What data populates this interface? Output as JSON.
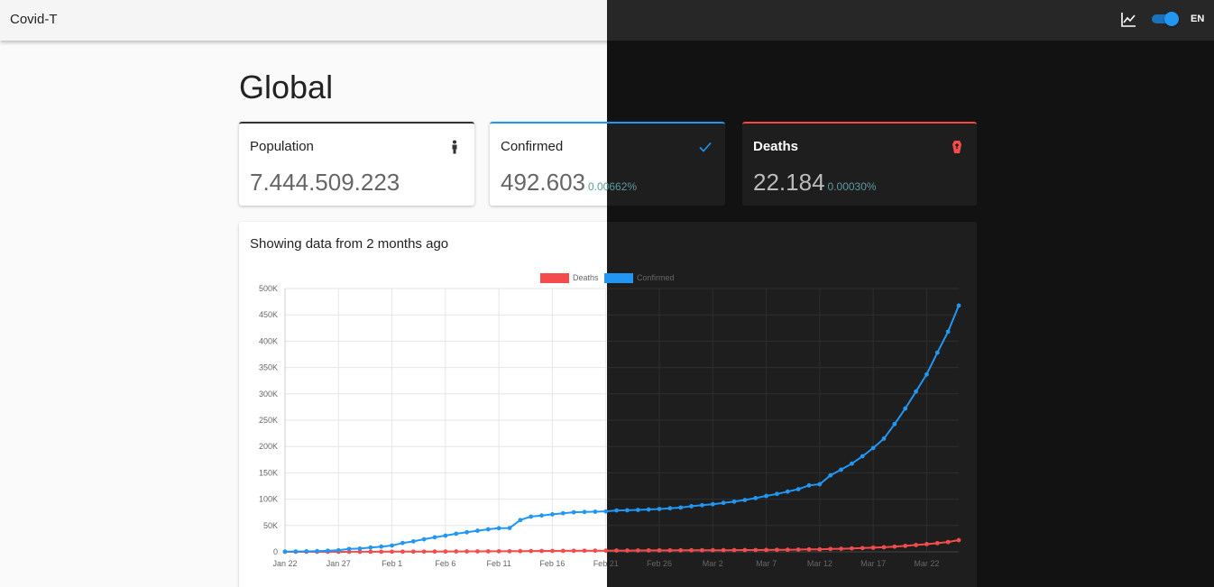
{
  "app": {
    "brand": "Covid-T",
    "language": "EN",
    "icons": {
      "chart": "chart-line-icon",
      "theme_toggle": "theme-toggle",
      "population": "person-icon",
      "confirmed": "check-icon",
      "deaths": "coffin-icon"
    },
    "theme": {
      "dark_mode": true,
      "accent": "#2196f3",
      "deaths_color": "#f44c4c"
    }
  },
  "page": {
    "title": "Global"
  },
  "cards": {
    "population": {
      "label": "Population",
      "value": "7.444.509.223"
    },
    "confirmed": {
      "label": "Confirmed",
      "value": "492.603",
      "percent": "0.00662%"
    },
    "deaths": {
      "label": "Deaths",
      "value": "22.184",
      "percent": "0.00030%"
    }
  },
  "chart_section": {
    "heading": "Showing data from 2 months ago"
  },
  "chart_data": {
    "type": "line",
    "title": "",
    "xlabel": "",
    "ylabel": "",
    "ylim": [
      0,
      500000
    ],
    "y_ticks": [
      "0",
      "50K",
      "100K",
      "150K",
      "200K",
      "250K",
      "300K",
      "350K",
      "400K",
      "450K",
      "500K"
    ],
    "x_tick_labels": [
      "Jan 22",
      "Jan 27",
      "Feb 1",
      "Feb 6",
      "Feb 11",
      "Feb 16",
      "Feb 21",
      "Feb 26",
      "Mar 2",
      "Mar 7",
      "Mar 12",
      "Mar 17",
      "Mar 22"
    ],
    "x_start": "Jan 22",
    "x_end": "Mar 25",
    "legend_position": "top",
    "grid": true,
    "series": [
      {
        "name": "Deaths",
        "color": "#f44c4c",
        "values": [
          17,
          18,
          26,
          42,
          56,
          82,
          131,
          133,
          171,
          213,
          259,
          362,
          426,
          492,
          564,
          634,
          719,
          806,
          906,
          1013,
          1113,
          1118,
          1371,
          1523,
          1666,
          1770,
          1868,
          2007,
          2122,
          2247,
          2251,
          2458,
          2469,
          2629,
          2708,
          2770,
          2814,
          2872,
          2941,
          2996,
          3085,
          3160,
          3254,
          3348,
          3460,
          3558,
          3802,
          3988,
          4262,
          4615,
          4720,
          5404,
          5819,
          6440,
          7126,
          7905,
          8733,
          9867,
          11299,
          12973,
          14623,
          16497,
          18615,
          22184
        ]
      },
      {
        "name": "Confirmed",
        "color": "#2196f3",
        "values": [
          555,
          654,
          941,
          1434,
          2118,
          2927,
          5578,
          6166,
          8234,
          9927,
          12038,
          16787,
          19881,
          23892,
          27635,
          30794,
          34391,
          37120,
          40150,
          42762,
          44802,
          45221,
          60368,
          66885,
          69030,
          71224,
          73258,
          75136,
          75639,
          76197,
          76819,
          78572,
          78958,
          79561,
          80406,
          81388,
          82746,
          84112,
          86604,
          88585,
          90443,
          93016,
          95314,
          98425,
          102050,
          106099,
          109991,
          114381,
          118948,
          126214,
          128343,
          145193,
          156099,
          167447,
          181546,
          197168,
          214915,
          242713,
          272167,
          304528,
          336953,
          378235,
          418045,
          467653
        ]
      }
    ]
  }
}
